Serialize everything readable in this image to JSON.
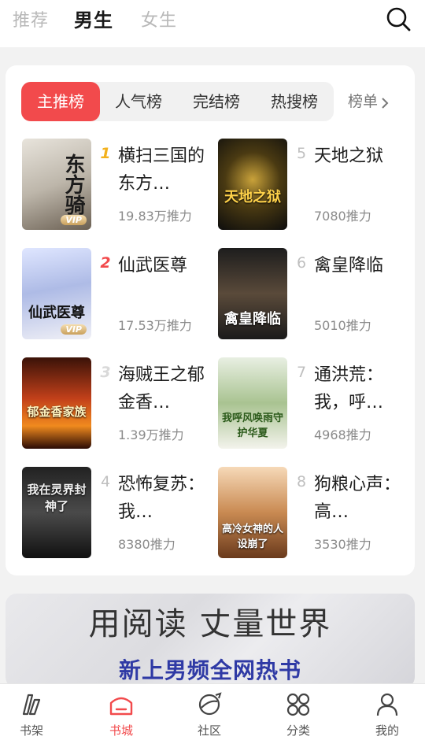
{
  "header": {
    "tabs": [
      {
        "label": "推荐"
      },
      {
        "label": "男生"
      },
      {
        "label": "女生"
      }
    ],
    "active_tab": "男生",
    "search_icon": "search-icon"
  },
  "ranking": {
    "tabs": [
      {
        "label": "主推榜"
      },
      {
        "label": "人气榜"
      },
      {
        "label": "完结榜"
      },
      {
        "label": "热搜榜"
      }
    ],
    "active_tab": "主推榜",
    "more_label": "榜单",
    "books": [
      {
        "rank": "1",
        "title": "横扫三国的东方…",
        "heat": "19.83万推力",
        "cover_text": "东方骑",
        "vip": "VIP"
      },
      {
        "rank": "2",
        "title": "仙武医尊",
        "heat": "17.53万推力",
        "cover_text": "仙武医尊",
        "vip": "VIP"
      },
      {
        "rank": "3",
        "title": "海贼王之郁金香…",
        "heat": "1.39万推力",
        "cover_text": "郁金香家族",
        "vip": ""
      },
      {
        "rank": "4",
        "title": "恐怖复苏：我…",
        "heat": "8380推力",
        "cover_text": "我在灵界封神了",
        "vip": ""
      },
      {
        "rank": "5",
        "title": "天地之狱",
        "heat": "7080推力",
        "cover_text": "天地之狱",
        "vip": ""
      },
      {
        "rank": "6",
        "title": "禽皇降临",
        "heat": "5010推力",
        "cover_text": "禽皇降临",
        "vip": ""
      },
      {
        "rank": "7",
        "title": "通洪荒：我，呼…",
        "heat": "4968推力",
        "cover_text": "我呼风唤雨守护华夏",
        "vip": ""
      },
      {
        "rank": "8",
        "title": "狗粮心声：高…",
        "heat": "3530推力",
        "cover_text": "高冷女神的人设崩了",
        "vip": ""
      }
    ]
  },
  "banner": {
    "headline": "用阅读 丈量世界",
    "subline": "新上男频全网热书"
  },
  "bottom_nav": {
    "items": [
      {
        "label": "书架",
        "icon": "bookshelf-icon"
      },
      {
        "label": "书城",
        "icon": "bookstore-icon"
      },
      {
        "label": "社区",
        "icon": "community-icon"
      },
      {
        "label": "分类",
        "icon": "category-icon"
      },
      {
        "label": "我的",
        "icon": "profile-icon"
      }
    ],
    "active": "书城"
  },
  "colors": {
    "accent": "#f24a4c",
    "rank1": "#f3b11c",
    "banner_sub": "#2f3aa5"
  }
}
